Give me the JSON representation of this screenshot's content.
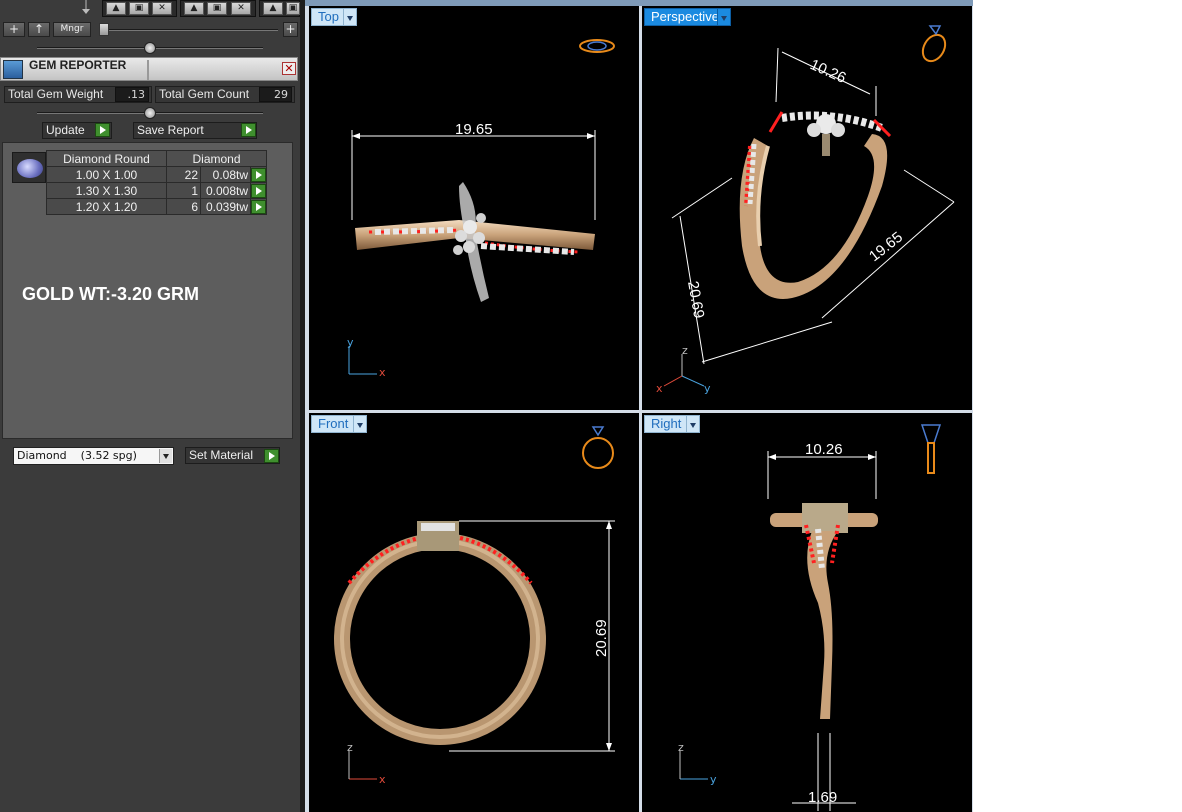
{
  "toolbar": {
    "mngr_label": "Mngr",
    "plus_label": "+",
    "up_label": "↑"
  },
  "panel": {
    "title": "GEM REPORTER",
    "total_weight_label": "Total Gem Weight",
    "total_weight_value": ".13",
    "total_count_label": "Total Gem Count",
    "total_count_value": "29",
    "update_label": "Update",
    "save_report_label": "Save Report"
  },
  "gem_table": {
    "headers": [
      "Diamond Round",
      "Diamond"
    ],
    "rows": [
      {
        "size": "1.00 X 1.00",
        "count": "22",
        "weight": "0.08tw"
      },
      {
        "size": "1.30 X 1.30",
        "count": "1",
        "weight": "0.008tw"
      },
      {
        "size": "1.20 X 1.20",
        "count": "6",
        "weight": "0.039tw"
      }
    ]
  },
  "gold_weight": "GOLD WT:-3.20 GRM",
  "material": {
    "selected": "Diamond    (3.52 spg)",
    "set_label": "Set Material"
  },
  "viewports": {
    "top": {
      "label": "Top",
      "width_dim": "19.65",
      "axis_v": "y",
      "axis_h": "x"
    },
    "perspective": {
      "label": "Perspective",
      "dim_a": "10.26",
      "dim_b": "19.65",
      "dim_c": "20.69",
      "axis_z": "z",
      "axis_x": "x",
      "axis_y": "y"
    },
    "front": {
      "label": "Front",
      "height_dim": "20.69",
      "axis_v": "z",
      "axis_h": "x"
    },
    "right": {
      "label": "Right",
      "width_dim": "10.26",
      "band_dim": "1.69",
      "axis_v": "z",
      "axis_h": "y"
    }
  },
  "colors": {
    "accent_blue": "#1b8ae0",
    "gold": "#c9a27a",
    "gem_marker": "#ff2020",
    "panel_bg": "#3b3b3b"
  }
}
